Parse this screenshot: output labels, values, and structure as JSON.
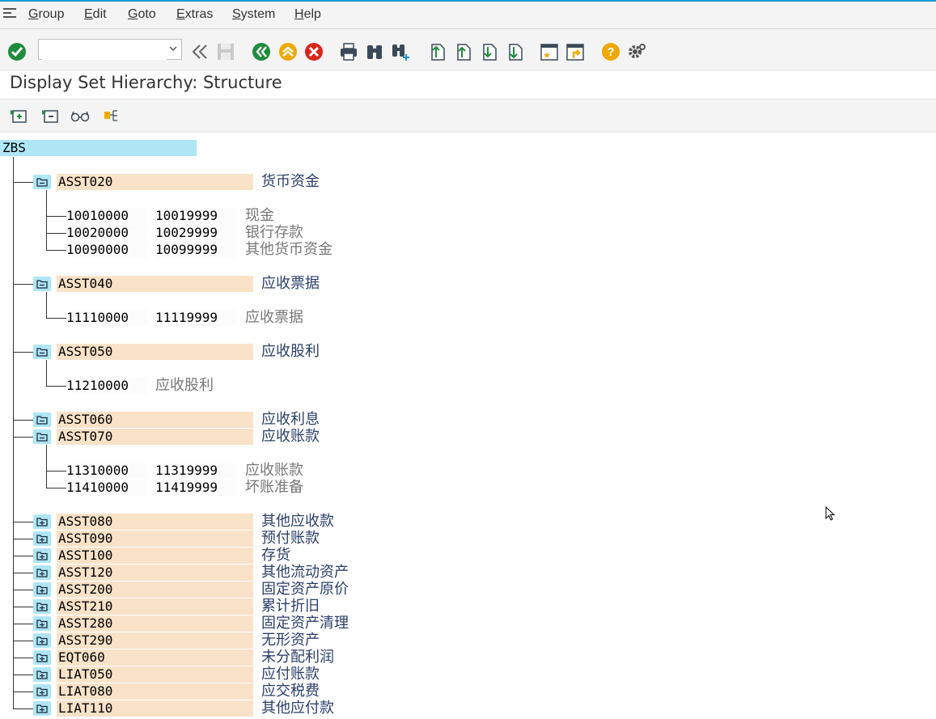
{
  "menu": {
    "items": [
      "Group",
      "Edit",
      "Goto",
      "Extras",
      "System",
      "Help"
    ]
  },
  "toolbar": {
    "command_value": ""
  },
  "page": {
    "title": "Display Set Hierarchy: Structure"
  },
  "colors": {
    "root_bg": "#aee6f5",
    "node_bg": "#f8e2c8",
    "folder_bg": "#aee6f5",
    "node_text": "#2a3f6a",
    "leaf_text": "#777777"
  },
  "tree": {
    "root": "ZBS",
    "nodes": [
      {
        "id": "ASST020",
        "text": "货币资金",
        "state": "open",
        "leaves": [
          {
            "from": "10010000",
            "to": "10019999",
            "text": "现金"
          },
          {
            "from": "10020000",
            "to": "10029999",
            "text": "银行存款"
          },
          {
            "from": "10090000",
            "to": "10099999",
            "text": "其他货币资金"
          }
        ]
      },
      {
        "id": "ASST040",
        "text": "应收票据",
        "state": "open",
        "leaves": [
          {
            "from": "11110000",
            "to": "11119999",
            "text": "应收票据"
          }
        ]
      },
      {
        "id": "ASST050",
        "text": "应收股利",
        "state": "open",
        "leaves": [
          {
            "from": "11210000",
            "to": "",
            "text": "应收股利"
          }
        ]
      },
      {
        "id": "ASST060",
        "text": "应收利息",
        "state": "open",
        "leaves": []
      },
      {
        "id": "ASST070",
        "text": "应收账款",
        "state": "open",
        "leaves": [
          {
            "from": "11310000",
            "to": "11319999",
            "text": "应收账款"
          },
          {
            "from": "11410000",
            "to": "11419999",
            "text": "坏账准备"
          }
        ]
      },
      {
        "id": "ASST080",
        "text": "其他应收款",
        "state": "closed",
        "leaves": []
      },
      {
        "id": "ASST090",
        "text": "预付账款",
        "state": "closed",
        "leaves": []
      },
      {
        "id": "ASST100",
        "text": "存货",
        "state": "closed",
        "leaves": []
      },
      {
        "id": "ASST120",
        "text": "其他流动资产",
        "state": "closed",
        "leaves": []
      },
      {
        "id": "ASST200",
        "text": "固定资产原价",
        "state": "closed",
        "leaves": []
      },
      {
        "id": "ASST210",
        "text": "累计折旧",
        "state": "closed",
        "leaves": []
      },
      {
        "id": "ASST280",
        "text": "固定资产清理",
        "state": "closed",
        "leaves": []
      },
      {
        "id": "ASST290",
        "text": "无形资产",
        "state": "closed",
        "leaves": []
      },
      {
        "id": "EQT060",
        "text": "未分配利润",
        "state": "closed",
        "leaves": []
      },
      {
        "id": "LIAT050",
        "text": "应付账款",
        "state": "closed",
        "leaves": []
      },
      {
        "id": "LIAT080",
        "text": "应交税费",
        "state": "closed",
        "leaves": []
      },
      {
        "id": "LIAT110",
        "text": "其他应付款",
        "state": "closed",
        "leaves": []
      }
    ]
  }
}
